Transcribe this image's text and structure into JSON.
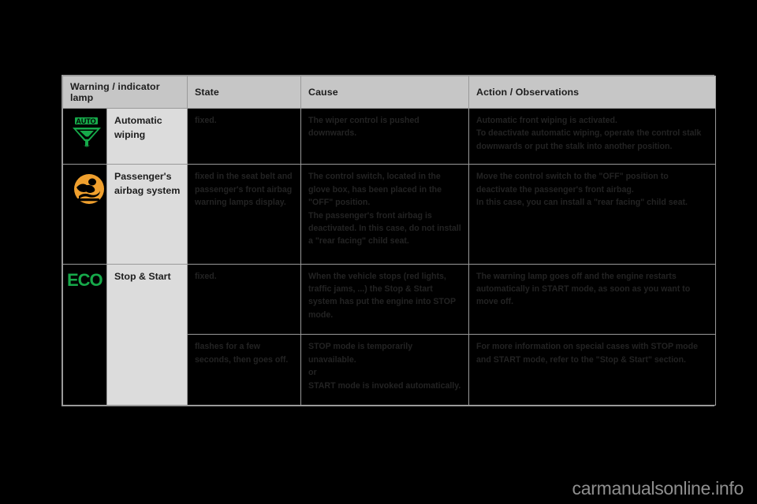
{
  "page": {
    "background_color": "#000000",
    "watermark": "carmanualsonline.info"
  },
  "table": {
    "headers": {
      "lamp": "Warning / indicator lamp",
      "state": "State",
      "cause": "Cause",
      "action": "Action / Observations"
    },
    "rows": [
      {
        "icon_name": "auto-wiper-icon",
        "icon_color": "#16a94a",
        "icon_label": "AUTO",
        "lamp": "Automatic\nwiping",
        "lamp_line1": "Automatic",
        "lamp_line2": "wiping",
        "state": "fixed.",
        "cause": "The wiper control is pushed downwards.",
        "action_line1": "Automatic front wiping is activated.",
        "action_line2": "To deactivate automatic wiping, operate the control stalk downwards or put the stalk into another position."
      },
      {
        "icon_name": "passenger-airbag-icon",
        "icon_color": "#f0a02e",
        "lamp_line1": "Passenger's",
        "lamp_line2": "airbag system",
        "state": "fixed in the seat belt and passenger's front airbag warning lamps display.",
        "cause_line1": "The control switch, located in the glove box, has been placed in the \"OFF\" position.",
        "cause_line2": "The passenger's front airbag is deactivated. In this case, do not install a \"rear facing\" child seat.",
        "action_line1": "Move the control switch to the \"OFF\" position to deactivate the passenger's front airbag.",
        "action_line2": "In this case, you can install a \"rear facing\" child seat."
      },
      {
        "icon_name": "eco-stop-start-icon",
        "icon_color": "#16a94a",
        "icon_label": "ECO",
        "lamp_line1": "Stop & Start",
        "state": "fixed.",
        "cause": "When the vehicle stops (red lights, traffic jams, ...) the Stop & Start system has put the engine into STOP mode.",
        "action": "The warning lamp goes off and the engine restarts automatically in START mode, as soon as you want to move off."
      },
      {
        "state": "flashes for a few seconds, then goes off.",
        "cause_line1": "STOP mode is temporarily unavailable.",
        "cause_line2": "or",
        "cause_line3": "START mode is invoked automatically.",
        "action": "For more information on special cases with STOP mode and START mode, refer to the \"Stop & Start\" section."
      }
    ]
  }
}
